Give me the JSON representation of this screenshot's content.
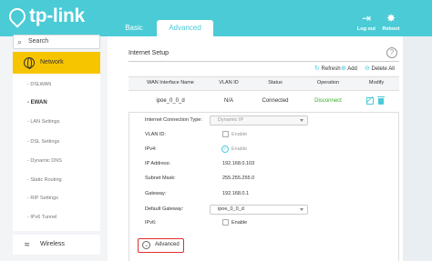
{
  "brand": {
    "name": "tp-link",
    "accent": "#4acbd6",
    "highlight": "#f7c500"
  },
  "tabs": [
    {
      "label": "Basic"
    },
    {
      "label": "Advanced",
      "active": true
    }
  ],
  "toolbar": {
    "logout_label": "Log out",
    "reboot_label": "Reboot",
    "logout_icon": "logout-icon",
    "reboot_icon": "reboot-icon"
  },
  "sidebar": {
    "search_placeholder": "Search",
    "section": {
      "label": "Network",
      "icon": "globe-icon"
    },
    "items": [
      {
        "label": "- DSLWAN"
      },
      {
        "label": "- EWAN",
        "active": true
      },
      {
        "label": "- LAN Settings"
      },
      {
        "label": "- DSL Settings"
      },
      {
        "label": "- Dynamic DNS"
      },
      {
        "label": "- Static Routing"
      },
      {
        "label": "- RIP Settings"
      },
      {
        "label": "- IPv6 Tunnel"
      }
    ],
    "wireless": {
      "label": "Wireless",
      "icon": "wifi-icon"
    }
  },
  "main": {
    "title": "Internet Setup",
    "help_glyph": "?",
    "actions": {
      "refresh": "Refresh",
      "add": "Add",
      "delete_all": "Delete All"
    },
    "table": {
      "headers": [
        "WAN Interface Name",
        "VLAN ID",
        "Status",
        "Operation",
        "Modify"
      ],
      "rows": [
        {
          "name": "ipoe_0_0_d",
          "vlan": "N/A",
          "status": "Connected",
          "operation": "Disconnect"
        }
      ]
    },
    "form": {
      "connection_type": {
        "label": "Internet Connection Type:",
        "value": "Dynamic IP"
      },
      "vlan_id": {
        "label": "VLAN ID:",
        "option": "Enable",
        "checked": false
      },
      "ipv4": {
        "label": "IPv4:",
        "option": "Enable",
        "checked": true
      },
      "ip_address": {
        "label": "IP Address:",
        "value": "192.168.0.103"
      },
      "subnet_mask": {
        "label": "Subnet Mask:",
        "value": "255.255.255.0"
      },
      "gateway": {
        "label": "Gateway:",
        "value": "192.168.0.1"
      },
      "default_gateway": {
        "label": "Default Gateway:",
        "value": "ipoe_0_0_d"
      },
      "ipv6": {
        "label": "IPv6:",
        "option": "Enable",
        "checked": false
      },
      "advanced_label": "Advanced"
    }
  }
}
